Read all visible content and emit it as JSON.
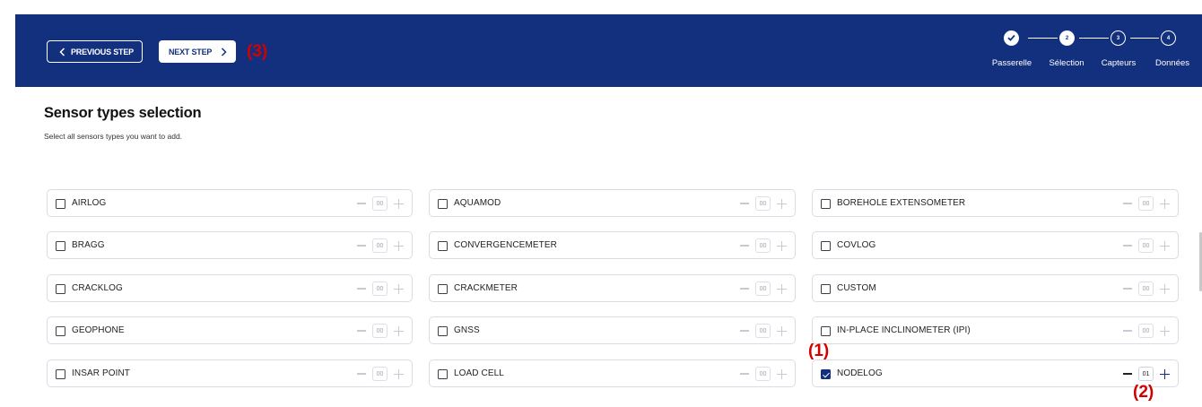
{
  "toolbar": {
    "previous_label": "PREVIOUS STEP",
    "next_label": "NEXT STEP",
    "next_annotation": "(3)"
  },
  "stepper": {
    "steps": [
      {
        "number": "",
        "label": "Passerelle",
        "state": "done",
        "icon": "check-icon"
      },
      {
        "number": "2",
        "label": "Sélection",
        "state": "active"
      },
      {
        "number": "3",
        "label": "Capteurs",
        "state": "todo"
      },
      {
        "number": "4",
        "label": "Données",
        "state": "todo"
      }
    ]
  },
  "page": {
    "title": "Sensor types selection",
    "subtitle": "Select all sensors types you want to add."
  },
  "sensors": [
    {
      "label": "AIRLOG",
      "qty": "00",
      "checked": false
    },
    {
      "label": "AQUAMOD",
      "qty": "00",
      "checked": false
    },
    {
      "label": "BOREHOLE EXTENSOMETER",
      "qty": "00",
      "checked": false
    },
    {
      "label": "BRAGG",
      "qty": "00",
      "checked": false
    },
    {
      "label": "CONVERGENCEMETER",
      "qty": "00",
      "checked": false
    },
    {
      "label": "COVLOG",
      "qty": "00",
      "checked": false
    },
    {
      "label": "CRACKLOG",
      "qty": "00",
      "checked": false
    },
    {
      "label": "CRACKMETER",
      "qty": "00",
      "checked": false
    },
    {
      "label": "CUSTOM",
      "qty": "00",
      "checked": false
    },
    {
      "label": "GEOPHONE",
      "qty": "00",
      "checked": false
    },
    {
      "label": "GNSS",
      "qty": "00",
      "checked": false
    },
    {
      "label": "IN-PLACE INCLINOMETER (IPI)",
      "qty": "00",
      "checked": false
    },
    {
      "label": "INSAR POINT",
      "qty": "00",
      "checked": false
    },
    {
      "label": "LOAD CELL",
      "qty": "00",
      "checked": false
    },
    {
      "label": "NODELOG",
      "qty": "01",
      "checked": true
    }
  ],
  "annotations": {
    "checkbox": "(1)",
    "stepper": "(2)"
  },
  "colors": {
    "header": "#13307f",
    "annotation": "#d40000",
    "border": "#d9dce3"
  }
}
